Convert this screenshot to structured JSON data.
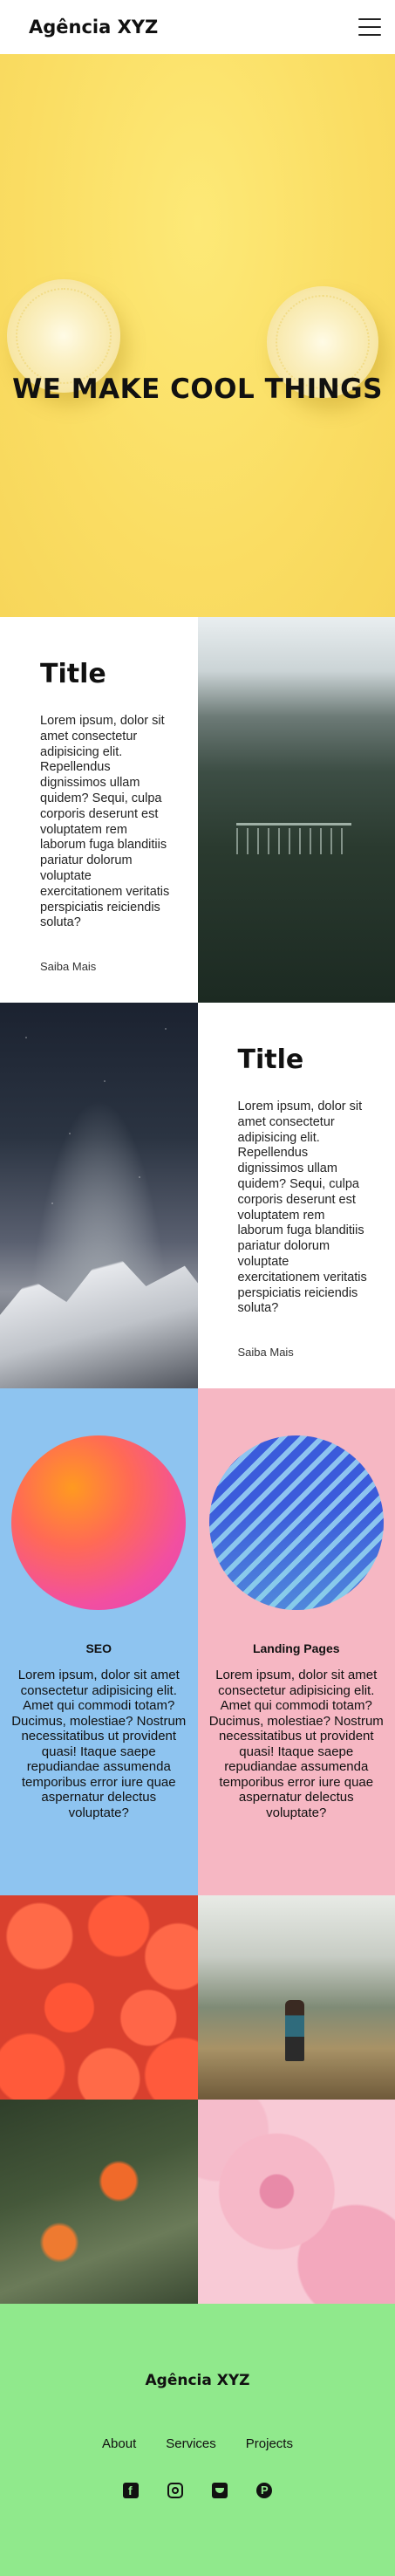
{
  "header": {
    "brand": "Agência XYZ",
    "menu_icon": "hamburger-menu-icon"
  },
  "hero": {
    "title": "WE MAKE COOL THINGS",
    "scroll_icon": "arrow-down-icon",
    "arrow_glyph": "↓"
  },
  "feature1": {
    "title": "Title",
    "body": "Lorem ipsum, dolor sit amet consectetur adipisicing elit. Repellendus dignissimos ullam quidem? Sequi, culpa corporis deserunt est voluptatem rem laborum fuga blanditiis pariatur dolorum voluptate exercitationem veritatis perspiciatis reiciendis soluta?",
    "link": "Saiba Mais"
  },
  "feature2": {
    "title": "Title",
    "body": "Lorem ipsum, dolor sit amet consectetur adipisicing elit. Repellendus dignissimos ullam quidem? Sequi, culpa corporis deserunt est voluptatem rem laborum fuga blanditiis pariatur dolorum voluptate exercitationem veritatis perspiciatis reiciendis soluta?",
    "link": "Saiba Mais"
  },
  "services": [
    {
      "title": "SEO",
      "body": "Lorem ipsum, dolor sit amet consectetur adipisicing elit. Amet qui commodi totam? Ducimus, molestiae? Nostrum necessitatibus ut provident quasi! Itaque saepe repudiandae assumenda temporibus error iure quae aspernatur delectus voluptate?"
    },
    {
      "title": "Landing Pages",
      "body": "Lorem ipsum, dolor sit amet consectetur adipisicing elit. Amet qui commodi totam? Ducimus, molestiae? Nostrum necessitatibus ut provident quasi! Itaque saepe repudiandae assumenda temporibus error iure quae aspernatur delectus voluptate?"
    }
  ],
  "footer": {
    "brand": "Agência XYZ",
    "nav": [
      "About",
      "Services",
      "Projects"
    ],
    "social_icons": [
      "facebook-icon",
      "instagram-icon",
      "twitter-icon",
      "pinterest-icon"
    ]
  },
  "colors": {
    "hero_bg": "#fadd63",
    "seo_bg": "#8ec4f0",
    "landing_bg": "#f6b7c3",
    "footer_bg": "#90e98c"
  }
}
